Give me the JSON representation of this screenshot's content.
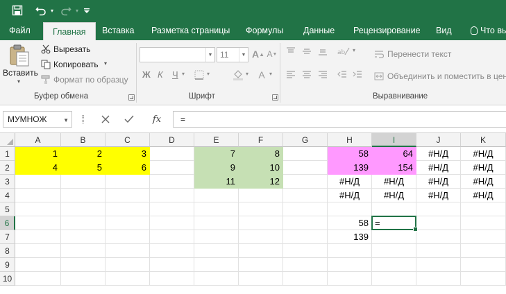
{
  "colors": {
    "accent": "#217346",
    "yellow": "#ffff00",
    "green": "#c6e0b4",
    "pink": "#ff99ff"
  },
  "tabs": [
    {
      "label": "Файл"
    },
    {
      "label": "Главная"
    },
    {
      "label": "Вставка"
    },
    {
      "label": "Разметка страницы"
    },
    {
      "label": "Формулы"
    },
    {
      "label": "Данные"
    },
    {
      "label": "Рецензирование"
    },
    {
      "label": "Вид"
    },
    {
      "label": "Что вы хотите сделать?"
    }
  ],
  "ribbon": {
    "clipboard": {
      "paste": "Вставить",
      "cut": "Вырезать",
      "copy": "Копировать",
      "format_painter": "Формат по образцу",
      "group": "Буфер обмена"
    },
    "font": {
      "font_name": "",
      "font_size": "11",
      "bold": "Ж",
      "italic": "К",
      "underline": "Ч",
      "group": "Шрифт"
    },
    "alignment": {
      "wrap": "Перенести текст",
      "merge": "Объединить и поместить в центре",
      "group": "Выравнивание"
    }
  },
  "formula_bar": {
    "name_box": "МУМНОЖ",
    "fx": "fx",
    "formula": "="
  },
  "grid": {
    "columns": [
      "A",
      "B",
      "C",
      "D",
      "E",
      "F",
      "G",
      "H",
      "I",
      "J",
      "K"
    ],
    "rows": [
      "1",
      "2",
      "3",
      "4",
      "5",
      "6",
      "7",
      "8",
      "9",
      "10"
    ],
    "cells": [
      {
        "col": 0,
        "row": 0,
        "text": "1",
        "fill": "yellow"
      },
      {
        "col": 1,
        "row": 0,
        "text": "2",
        "fill": "yellow"
      },
      {
        "col": 2,
        "row": 0,
        "text": "3",
        "fill": "yellow"
      },
      {
        "col": 0,
        "row": 1,
        "text": "4",
        "fill": "yellow"
      },
      {
        "col": 1,
        "row": 1,
        "text": "5",
        "fill": "yellow"
      },
      {
        "col": 2,
        "row": 1,
        "text": "6",
        "fill": "yellow"
      },
      {
        "col": 4,
        "row": 0,
        "text": "7",
        "fill": "green"
      },
      {
        "col": 5,
        "row": 0,
        "text": "8",
        "fill": "green"
      },
      {
        "col": 4,
        "row": 1,
        "text": "9",
        "fill": "green"
      },
      {
        "col": 5,
        "row": 1,
        "text": "10",
        "fill": "green"
      },
      {
        "col": 4,
        "row": 2,
        "text": "11",
        "fill": "green"
      },
      {
        "col": 5,
        "row": 2,
        "text": "12",
        "fill": "green"
      },
      {
        "col": 7,
        "row": 0,
        "text": "58",
        "fill": "pink"
      },
      {
        "col": 8,
        "row": 0,
        "text": "64",
        "fill": "pink"
      },
      {
        "col": 7,
        "row": 1,
        "text": "139",
        "fill": "pink"
      },
      {
        "col": 8,
        "row": 1,
        "text": "154",
        "fill": "pink"
      },
      {
        "col": 9,
        "row": 0,
        "text": "#Н/Д",
        "align": "center"
      },
      {
        "col": 10,
        "row": 0,
        "text": "#Н/Д",
        "align": "center"
      },
      {
        "col": 9,
        "row": 1,
        "text": "#Н/Д",
        "align": "center"
      },
      {
        "col": 10,
        "row": 1,
        "text": "#Н/Д",
        "align": "center"
      },
      {
        "col": 7,
        "row": 2,
        "text": "#Н/Д",
        "align": "center"
      },
      {
        "col": 8,
        "row": 2,
        "text": "#Н/Д",
        "align": "center"
      },
      {
        "col": 9,
        "row": 2,
        "text": "#Н/Д",
        "align": "center"
      },
      {
        "col": 10,
        "row": 2,
        "text": "#Н/Д",
        "align": "center"
      },
      {
        "col": 7,
        "row": 3,
        "text": "#Н/Д",
        "align": "center"
      },
      {
        "col": 8,
        "row": 3,
        "text": "#Н/Д",
        "align": "center"
      },
      {
        "col": 9,
        "row": 3,
        "text": "#Н/Д",
        "align": "center"
      },
      {
        "col": 10,
        "row": 3,
        "text": "#Н/Д",
        "align": "center"
      },
      {
        "col": 7,
        "row": 5,
        "text": "58"
      },
      {
        "col": 8,
        "row": 5,
        "text": "=",
        "align": "left"
      },
      {
        "col": 7,
        "row": 6,
        "text": "139"
      }
    ],
    "active": {
      "col": 8,
      "row": 5
    }
  }
}
